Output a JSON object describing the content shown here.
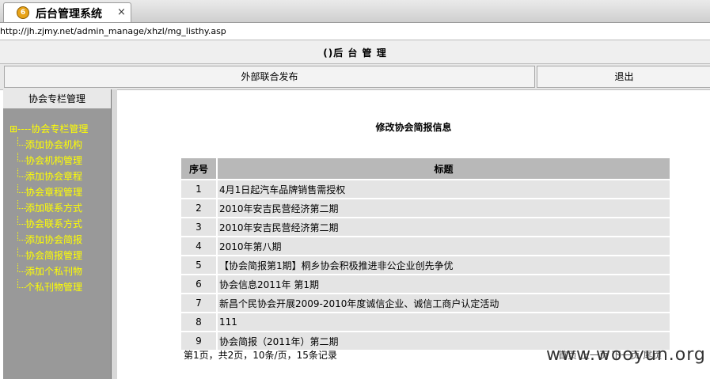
{
  "browser": {
    "tab_title": "后台管理系统",
    "tab_icon": "6",
    "close_glyph": "×",
    "url": "http://jh.zjmy.net/admin_manage/xhzl/mg_listhy.asp"
  },
  "header": {
    "title": "()后 台 管 理",
    "nav": [
      "外部联合发布",
      "退出"
    ]
  },
  "sidebar": {
    "heading": "协会专栏管理",
    "root": "⊞----协会专栏管理",
    "items": [
      "添加协会机构",
      "协会机构管理",
      "添加协会章程",
      "协会章程管理",
      "添加联系方式",
      "协会联系方式",
      "添加协会简报",
      "协会简报管理",
      "添加个私刊物",
      "个私刊物管理"
    ]
  },
  "main": {
    "title": "修改协会简报信息",
    "columns": [
      "序号",
      "标题"
    ],
    "rows": [
      {
        "no": "1",
        "title": "4月1日起汽车品牌销售需授权"
      },
      {
        "no": "2",
        "title": "2010年安吉民营经济第二期"
      },
      {
        "no": "3",
        "title": "2010年安吉民营经济第二期"
      },
      {
        "no": "4",
        "title": "2010年第八期"
      },
      {
        "no": "5",
        "title": "【协会简报第1期】桐乡协会积极推进非公企业创先争优"
      },
      {
        "no": "6",
        "title": "协会信息2011年 第1期"
      },
      {
        "no": "7",
        "title": "新昌个民协会开展2009-2010年度诚信企业、诚信工商户认定活动"
      },
      {
        "no": "8",
        "title": "111"
      },
      {
        "no": "9",
        "title": "协会简报（2011年）第二期"
      }
    ],
    "pager": "第1页，共2页，10条/页，15条记录",
    "pager_links": "首页 上一页 下一页 尾页"
  },
  "watermark": "www.wooyun.org",
  "colors": {
    "tree_text": "#ffff00",
    "sidebar_bg": "#999999",
    "header_cell": "#b8b8b8"
  }
}
